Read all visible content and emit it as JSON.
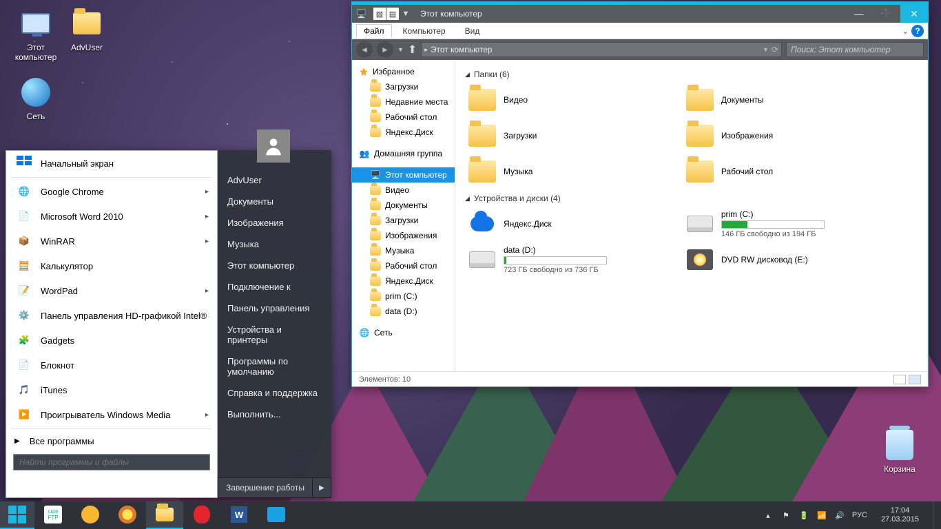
{
  "desktop_icons": {
    "computer": "Этот компьютер",
    "advuser": "AdvUser",
    "network": "Сеть",
    "recycle": "Корзина"
  },
  "startmenu": {
    "start_screen": "Начальный экран",
    "apps": [
      "Google Chrome",
      "Microsoft Word 2010",
      "WinRAR",
      "Калькулятор",
      "WordPad",
      "Панель управления HD-графикой Intel®",
      "Gadgets",
      "Блокнот",
      "iTunes",
      "Проигрыватель Windows Media"
    ],
    "all_programs": "Все программы",
    "search_placeholder": "Найти программы и файлы",
    "right": {
      "user": "AdvUser",
      "items": [
        "Документы",
        "Изображения",
        "Музыка",
        "Этот компьютер",
        "Подключение к",
        "Панель управления",
        "Устройства и принтеры",
        "Программы по умолчанию",
        "Справка и поддержка",
        "Выполнить..."
      ],
      "shutdown": "Завершение работы"
    }
  },
  "explorer": {
    "title": "Этот компьютер",
    "ribbon": {
      "file": "Файл",
      "computer": "Компьютер",
      "view": "Вид"
    },
    "addr": "Этот компьютер",
    "search_placeholder": "Поиск: Этот компьютер",
    "nav": {
      "favorites": "Избранное",
      "fav_items": [
        "Загрузки",
        "Недавние места",
        "Рабочий стол",
        "Яндекс.Диск"
      ],
      "homegroup": "Домашняя группа",
      "thispc": "Этот компьютер",
      "pc_items": [
        "Видео",
        "Документы",
        "Загрузки",
        "Изображения",
        "Музыка",
        "Рабочий стол",
        "Яндекс.Диск",
        "prim (C:)",
        "data (D:)"
      ],
      "network": "Сеть"
    },
    "sections": {
      "folders": "Папки (6)",
      "devices": "Устройства и диски (4)"
    },
    "folders": [
      "Видео",
      "Документы",
      "Загрузки",
      "Изображения",
      "Музыка",
      "Рабочий стол"
    ],
    "drives": {
      "yadisk": "Яндекс.Диск",
      "c": {
        "label": "prim (C:)",
        "free": "146 ГБ свободно из 194 ГБ",
        "pct": 25
      },
      "d": {
        "label": "data (D:)",
        "free": "723 ГБ свободно из 736 ГБ",
        "pct": 2
      },
      "dvd": "DVD RW дисковод (E:)"
    },
    "status": "Элементов: 10"
  },
  "taskbar": {
    "lang": "РУС",
    "time": "17:04",
    "date": "27.03.2015"
  }
}
